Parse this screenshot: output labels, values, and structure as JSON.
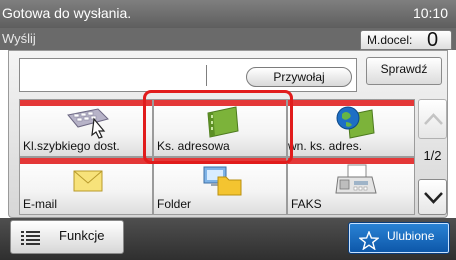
{
  "status": {
    "message": "Gotowa do wysłania.",
    "time": "10:10"
  },
  "title_bar": {
    "title": "Wyślij",
    "destination_label": "M.docel:",
    "destination_count": "0"
  },
  "search": {
    "recall_label": "Przywołaj",
    "check_label": "Sprawdź"
  },
  "tiles": [
    {
      "label": "Kl.szybkiego dost.",
      "icon": "speed-dial-keyboard-icon"
    },
    {
      "label": "Ks. adresowa",
      "icon": "address-book-icon"
    },
    {
      "label": "Zewn. ks. adres.",
      "icon": "external-address-book-icon"
    },
    {
      "label": "E-mail",
      "icon": "envelope-icon"
    },
    {
      "label": "Folder",
      "icon": "folder-icon"
    },
    {
      "label": "FAKS",
      "icon": "fax-machine-icon"
    }
  ],
  "pager": {
    "page_indicator": "1/2"
  },
  "bottom": {
    "functions_label": "Funkcje",
    "favorites_label": "Ulubione"
  },
  "colors": {
    "tile_accent": "#e43838",
    "highlight": "#e11c1c",
    "favorites": "#1569c0"
  }
}
